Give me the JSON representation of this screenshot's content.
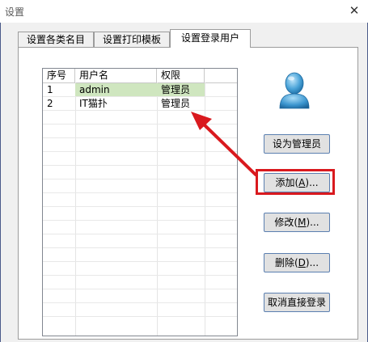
{
  "window": {
    "title": "设置",
    "close_glyph": "✕"
  },
  "tabs": [
    {
      "label": "设置各类名目",
      "active": false
    },
    {
      "label": "设置打印模板",
      "active": false
    },
    {
      "label": "设置登录用户",
      "active": true
    }
  ],
  "user_list": {
    "columns": [
      "序号",
      "用户名",
      "权限"
    ],
    "rows": [
      {
        "index": "1",
        "username": "admin",
        "role": "管理员",
        "selected": true
      },
      {
        "index": "2",
        "username": "IT猫扑",
        "role": "管理员",
        "selected": false
      }
    ]
  },
  "buttons": {
    "set_admin": "设为管理员",
    "add": {
      "text": "添加(",
      "mnemonic": "A",
      "suffix": ")..."
    },
    "modify": {
      "text": "修改(",
      "mnemonic": "M",
      "suffix": ")..."
    },
    "delete": {
      "text": "删除(",
      "mnemonic": "D",
      "suffix": ")..."
    },
    "cancel_direct_login": "取消直接登录"
  },
  "icons": {
    "user_avatar": "user-avatar-icon",
    "arrow": "annotation-arrow"
  },
  "colors": {
    "selection": "#cfe6bf",
    "annotation": "#d9191e",
    "button_border": "#5b7fb0"
  }
}
